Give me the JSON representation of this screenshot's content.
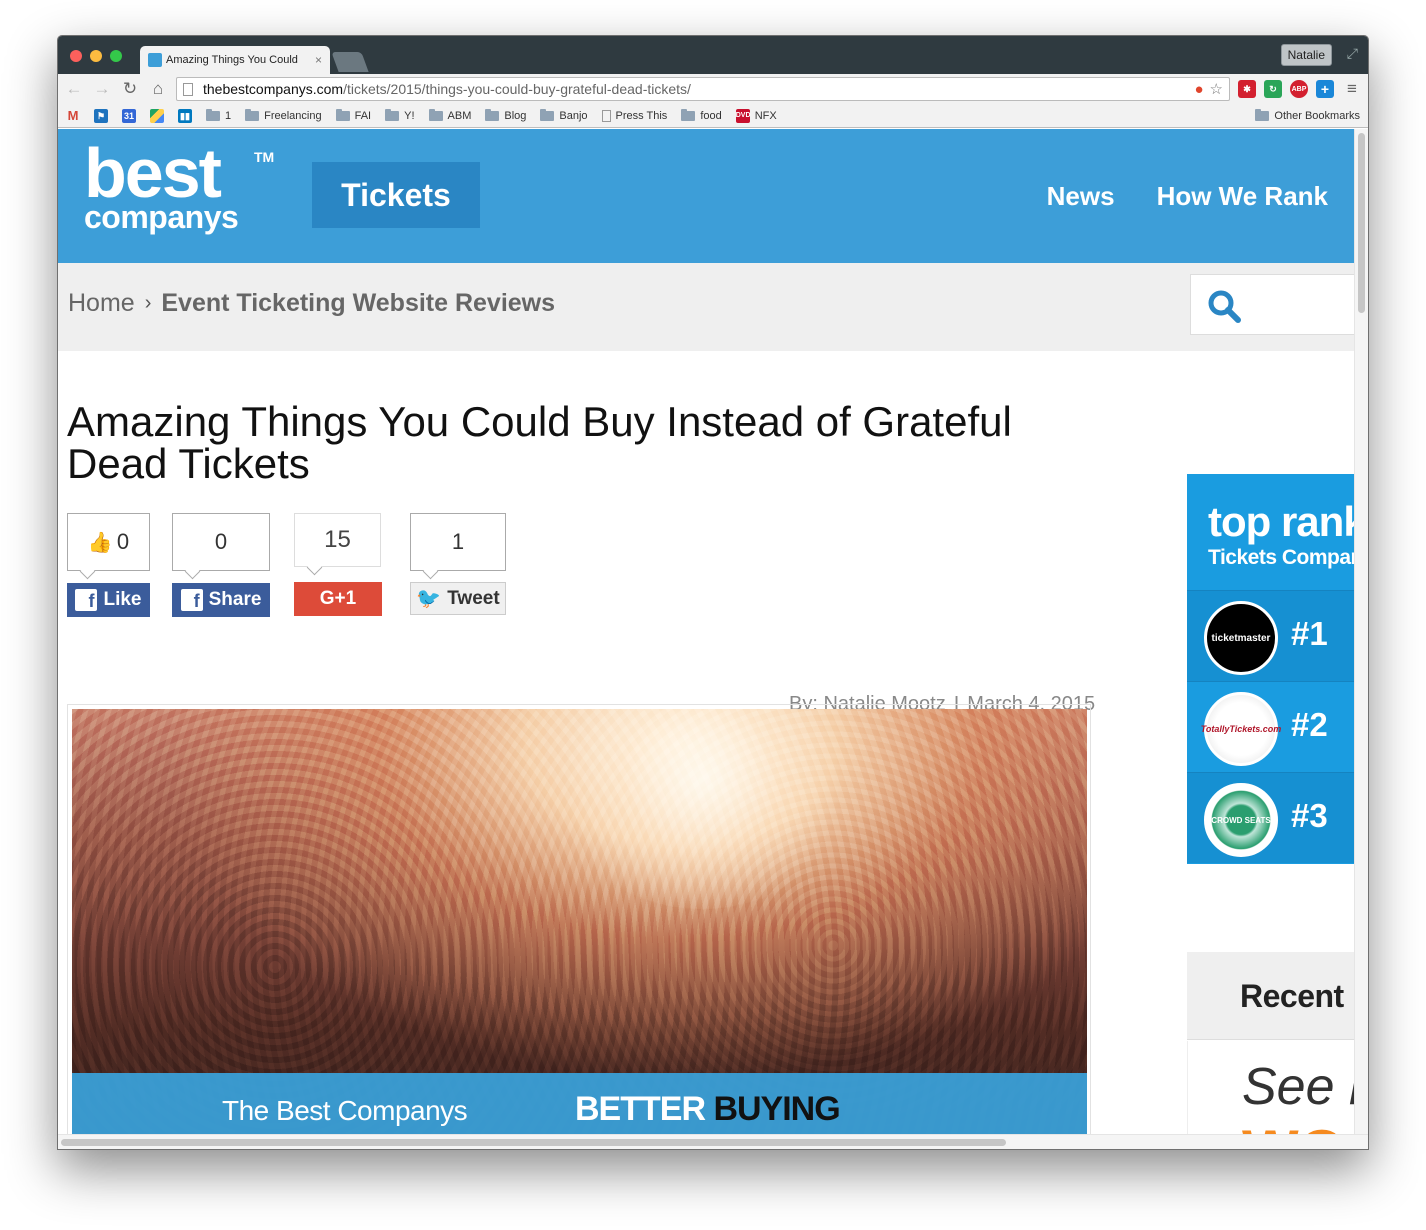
{
  "browser": {
    "tab_title": "Amazing Things You Could",
    "tab_close": "×",
    "profile_name": "Natalie",
    "url_host": "thebestcompanys.com",
    "url_path": "/tickets/2015/things-you-could-buy-grateful-dead-tickets/",
    "bookmarks": [
      "1",
      "Freelancing",
      "FAI",
      "Y!",
      "ABM",
      "Blog",
      "Banjo",
      "Press This",
      "food",
      "NFX"
    ],
    "other_bookmarks": "Other Bookmarks",
    "ext_abp": "ABP"
  },
  "site": {
    "logo_best": "best",
    "logo_companys": "companys",
    "logo_tm": "TM",
    "category": "Tickets",
    "nav": {
      "news": "News",
      "how_we_rank": "How We Rank"
    }
  },
  "breadcrumb": {
    "home": "Home",
    "separator": "›",
    "current": "Event Ticketing Website Reviews"
  },
  "article": {
    "title": "Amazing Things You Could Buy Instead of Grateful Dead Tickets",
    "byline": "By: Natalie Mootz",
    "divider": "I",
    "date": "March 4, 2015"
  },
  "social": {
    "like_count": "0",
    "like_label": "Like",
    "share_count": "0",
    "share_label": "Share",
    "gplus_count": "15",
    "gplus_label": "G+1",
    "tweet_count": "1",
    "tweet_label": "Tweet"
  },
  "hero": {
    "brand_text": "The Best Companys",
    "better": "BETTER",
    "buying": "BUYING"
  },
  "sidebar": {
    "rank_title": "top rank",
    "rank_subtitle": "Tickets Compan",
    "rankings": [
      {
        "rank": "#1",
        "logo": "ticketmaster"
      },
      {
        "rank": "#2",
        "logo": "TotallyTickets.com"
      },
      {
        "rank": "#3",
        "logo": "CROWD SEATS"
      }
    ],
    "recent_title": "Recent",
    "promo_line1": "See h",
    "promo_line2": "WO"
  },
  "colors": {
    "brand_blue": "#3d9ed8",
    "tickets_button": "#2a86c4",
    "rank_panel": "#1a9ce0",
    "facebook": "#3b5c9b",
    "google_plus": "#dd4b39",
    "promo_orange": "#f58a1f"
  }
}
